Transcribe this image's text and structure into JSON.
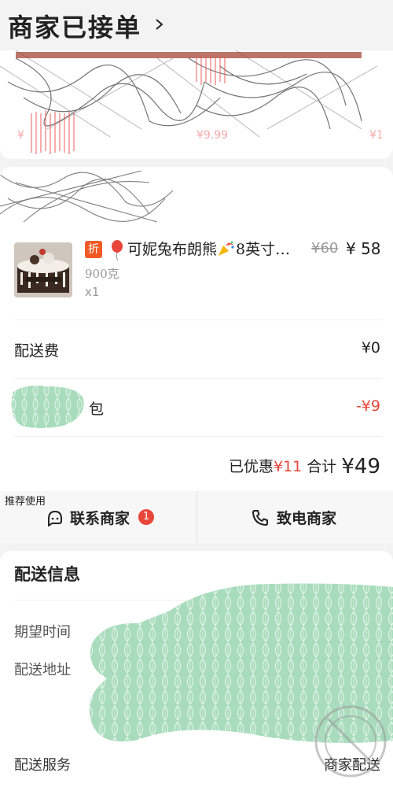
{
  "header": {
    "title": "商家已接单"
  },
  "product": {
    "discount_tag": "折",
    "name_prefix": "可妮兔布朗熊",
    "name_suffix": "8英寸…",
    "original_price": "¥60",
    "price": "¥ 58",
    "spec": "900克",
    "quantity": "x1"
  },
  "fees": {
    "delivery_label": "配送费",
    "delivery_value": "¥0",
    "redpacket_label": "包",
    "redpacket_value": "-¥9"
  },
  "summary": {
    "discount_label": "已优惠",
    "discount_value": "¥11",
    "total_label": "合计",
    "total_value": "¥49"
  },
  "actions": {
    "recommend_badge": "推荐使用",
    "contact_label": "联系商家",
    "contact_unread": "1",
    "call_label": "致电商家"
  },
  "delivery": {
    "section_title": "配送信息",
    "expected_time_label": "期望时间",
    "address_label": "配送地址",
    "service_label": "配送服务",
    "service_value": "商家配送"
  },
  "colors": {
    "accent_red": "#e8463a",
    "tag_orange": "#f15a24",
    "redaction_green": "#a8dcbc"
  },
  "icons": {
    "header_chevron": "chevron-right-icon",
    "contact": "chat-bubble-icon",
    "call": "phone-icon"
  }
}
